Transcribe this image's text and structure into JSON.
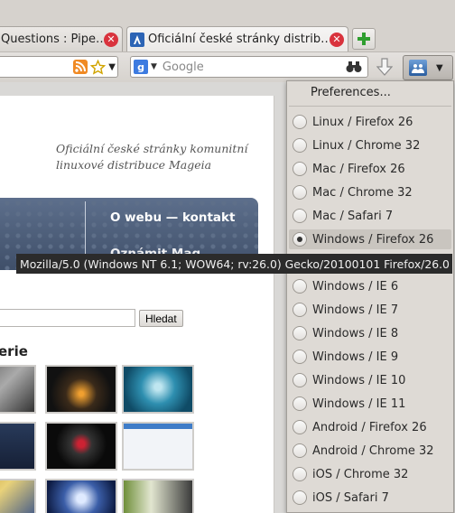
{
  "tabs": [
    {
      "label": "Questions : Pipe…",
      "active": false
    },
    {
      "label": "Oficiální české stránky distrib…",
      "active": true
    }
  ],
  "search": {
    "placeholder": "Google",
    "engine_icon": "google-icon"
  },
  "page": {
    "tagline": "Oficiální české stránky komunitní linuxové distribuce Mageia",
    "nav_link": "O webu — kontakt",
    "nav_link_2": "Oznámit Mag…",
    "search_button": "Hledat",
    "section_heading": "erie"
  },
  "menu": {
    "preferences": "Preferences...",
    "items": [
      {
        "label": "Linux / Firefox 26",
        "selected": false
      },
      {
        "label": "Linux / Chrome 32",
        "selected": false
      },
      {
        "label": "Mac / Firefox 26",
        "selected": false
      },
      {
        "label": "Mac / Chrome 32",
        "selected": false
      },
      {
        "label": "Mac / Safari 7",
        "selected": false
      },
      {
        "label": "Windows / Firefox 26",
        "selected": true
      },
      {
        "label": "Windows / Chrome 32",
        "selected": false
      },
      {
        "label": "Windows / IE 6",
        "selected": false
      },
      {
        "label": "Windows / IE 7",
        "selected": false
      },
      {
        "label": "Windows / IE 8",
        "selected": false
      },
      {
        "label": "Windows / IE 9",
        "selected": false
      },
      {
        "label": "Windows / IE 10",
        "selected": false
      },
      {
        "label": "Windows / IE 11",
        "selected": false
      },
      {
        "label": "Android / Firefox 26",
        "selected": false
      },
      {
        "label": "Android / Chrome 32",
        "selected": false
      },
      {
        "label": "iOS / Chrome 32",
        "selected": false
      },
      {
        "label": "iOS / Safari 7",
        "selected": false
      }
    ]
  },
  "tooltip": "Mozilla/5.0 (Windows NT 6.1; WOW64; rv:26.0) Gecko/20100101 Firefox/26.0",
  "colors": {
    "close_red": "#d9333d",
    "new_tab_green": "#2f9e2f",
    "banner": "#4a5a76"
  }
}
